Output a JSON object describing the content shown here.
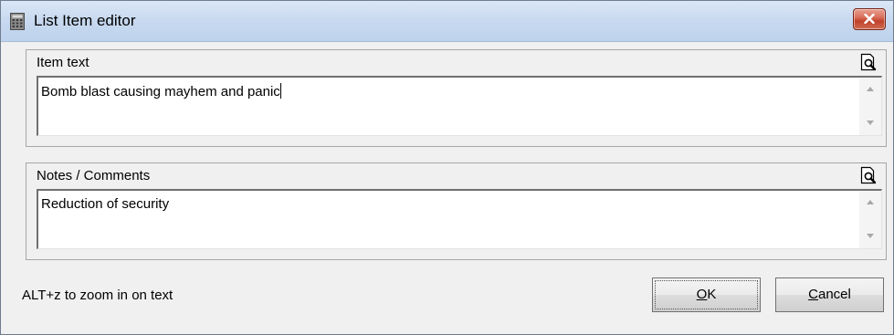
{
  "window": {
    "title": "List Item editor"
  },
  "item_group": {
    "label": "Item text",
    "value": "Bomb blast causing mayhem and panic"
  },
  "notes_group": {
    "label": "Notes / Comments",
    "value": "Reduction of security"
  },
  "footer": {
    "hint": "ALT+z to zoom in on text",
    "ok_mnemonic": "O",
    "ok_rest": "K",
    "cancel_mnemonic": "C",
    "cancel_rest": "ancel"
  },
  "icons": {
    "app": "calculator-icon",
    "close": "close-icon",
    "zoom": "magnifier-document-icon",
    "scroll_up": "arrow-up-icon",
    "scroll_down": "arrow-down-icon"
  },
  "colors": {
    "close_button": "#c9543d",
    "titlebar": "#c9daf0",
    "dialog_background": "#f0f0f0"
  }
}
